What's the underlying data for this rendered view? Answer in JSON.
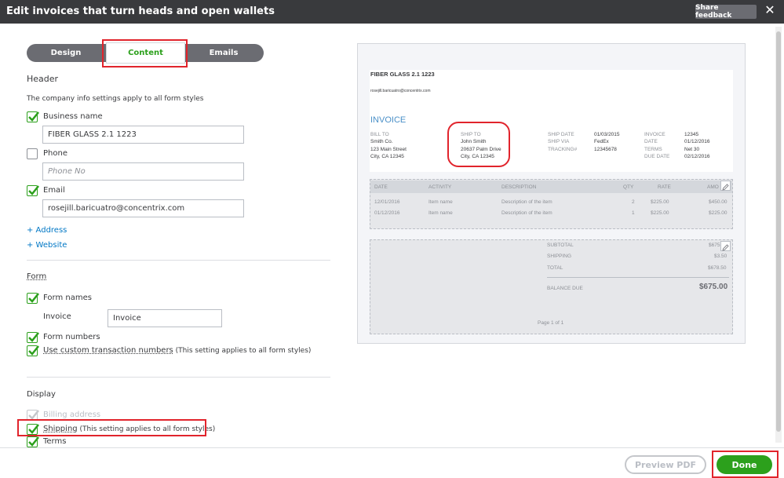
{
  "window": {
    "title": "Edit invoices that turn heads and open wallets",
    "feedback_label": "Share feedback",
    "close_icon": "close-icon"
  },
  "tabs": [
    {
      "label": "Design"
    },
    {
      "label": "Content",
      "active": true
    },
    {
      "label": "Emails"
    }
  ],
  "header_section": {
    "heading": "Header",
    "note": "The company info settings apply to all form styles",
    "business_name": {
      "label": "Business name",
      "checked": true,
      "value": "FIBER GLASS 2.1 1223"
    },
    "phone": {
      "label": "Phone",
      "checked": false,
      "placeholder": "Phone No"
    },
    "email": {
      "label": "Email",
      "checked": true,
      "value": "rosejill.baricuatro@concentrix.com"
    },
    "add_address": "+ Address",
    "add_website": "+ Website"
  },
  "form_section": {
    "heading": "Form",
    "form_names": {
      "label": "Form names",
      "checked": true
    },
    "invoice_label": "Invoice",
    "invoice_value": "Invoice",
    "form_numbers": {
      "label": "Form numbers",
      "checked": true
    },
    "custom_numbers": {
      "label": "Use custom transaction numbers",
      "suffix": " (This setting applies to all form styles)",
      "checked": true
    }
  },
  "display_section": {
    "heading": "Display",
    "billing_address": {
      "label": "Billing address",
      "checked": true,
      "disabled": true
    },
    "shipping": {
      "label": "Shipping",
      "suffix": " (This setting applies to all form styles)",
      "checked": true
    },
    "terms": {
      "label": "Terms",
      "checked": true
    }
  },
  "preview": {
    "company": "FIBER GLASS 2.1 1223",
    "email": "rosejill.baricuatro@concentrix.com",
    "doc_title": "INVOICE",
    "bill_to_label": "BILL TO",
    "bill_to": [
      "Smith Co.",
      "123 Main Street",
      "City, CA 12345"
    ],
    "ship_to_label": "SHIP TO",
    "ship_to": [
      "John Smith",
      "20637 Palm Drive",
      "City, CA 12345"
    ],
    "ship_meta": [
      {
        "label": "SHIP DATE",
        "value": "01/03/2015"
      },
      {
        "label": "SHIP VIA",
        "value": "FedEx"
      },
      {
        "label": "TRACKING#",
        "value": "12345678"
      }
    ],
    "inv_meta": [
      {
        "label": "INVOICE",
        "value": "12345"
      },
      {
        "label": "DATE",
        "value": "01/12/2016"
      },
      {
        "label": "TERMS",
        "value": "Net 30"
      },
      {
        "label": "DUE DATE",
        "value": "02/12/2016"
      }
    ],
    "columns": [
      "DATE",
      "ACTIVITY",
      "DESCRIPTION",
      "QTY",
      "RATE",
      "AMO"
    ],
    "rows": [
      {
        "date": "12/01/2016",
        "activity": "Item name",
        "description": "Description of the item",
        "qty": "2",
        "rate": "$225.00",
        "amount": "$450.00"
      },
      {
        "date": "01/12/2016",
        "activity": "Item name",
        "description": "Description of the item",
        "qty": "1",
        "rate": "$225.00",
        "amount": "$225.00"
      }
    ],
    "subtotal_label": "SUBTOTAL",
    "subtotal": "$675",
    "shipping_label": "SHIPPING",
    "shipping": "$3.50",
    "total_label": "TOTAL",
    "total": "$678.50",
    "balance_label": "BALANCE DUE",
    "balance": "$675.00",
    "page_label": "Page 1 of 1"
  },
  "footer": {
    "preview_pdf": "Preview PDF",
    "done": "Done"
  },
  "colors": {
    "accent_green": "#2ca01c",
    "highlight_red": "#e1242c",
    "link_blue": "#0077c5",
    "header_dark": "#393a3d"
  }
}
